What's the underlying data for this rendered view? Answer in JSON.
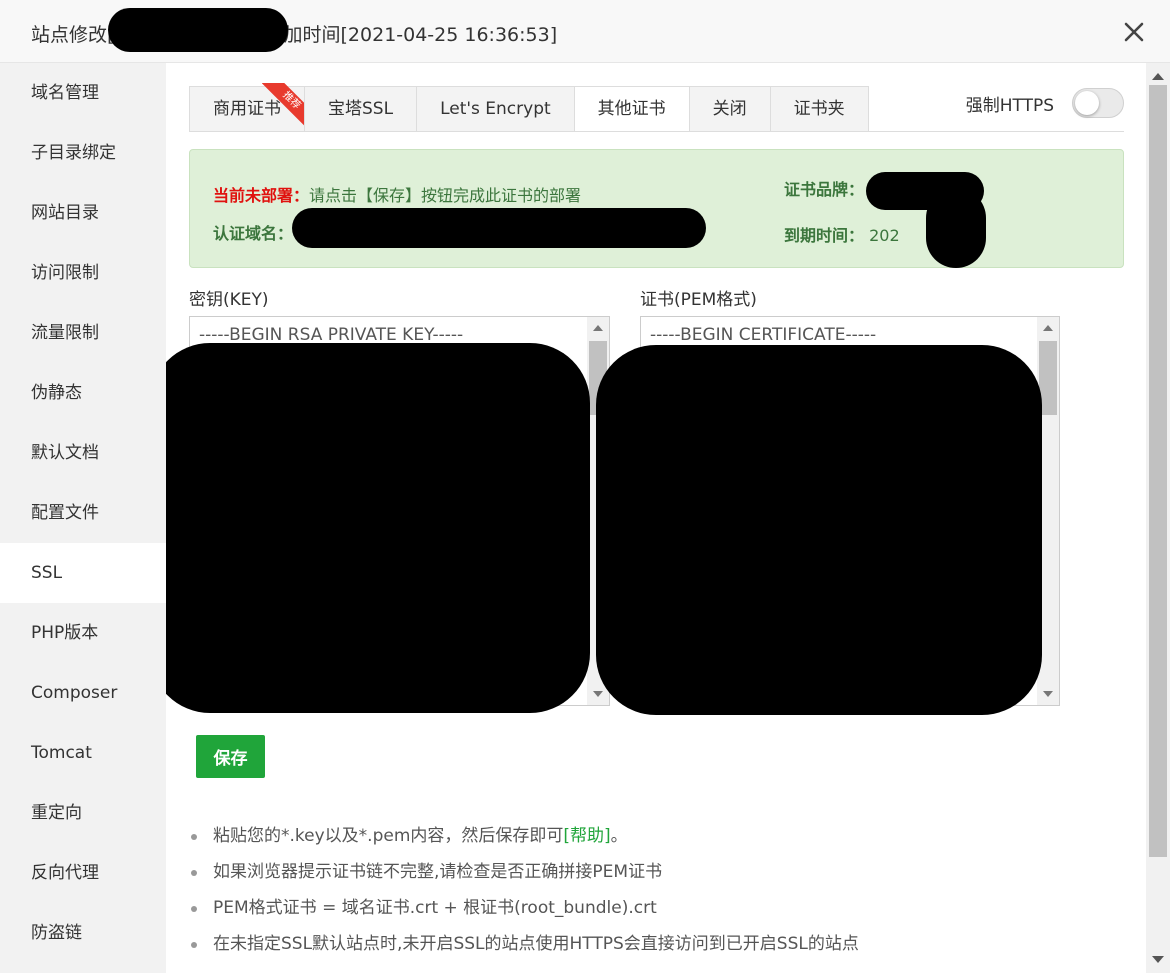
{
  "window": {
    "title": "站点修改[████████] -- 添加时间[2021-04-25 16:36:53]"
  },
  "sidebar": {
    "items": [
      {
        "label": "域名管理"
      },
      {
        "label": "子目录绑定"
      },
      {
        "label": "网站目录"
      },
      {
        "label": "访问限制"
      },
      {
        "label": "流量限制"
      },
      {
        "label": "伪静态"
      },
      {
        "label": "默认文档"
      },
      {
        "label": "配置文件"
      },
      {
        "label": "SSL",
        "active": true
      },
      {
        "label": "PHP版本"
      },
      {
        "label": "Composer"
      },
      {
        "label": "Tomcat"
      },
      {
        "label": "重定向"
      },
      {
        "label": "反向代理"
      },
      {
        "label": "防盗链"
      }
    ]
  },
  "tabs": [
    {
      "label": "商用证书",
      "badge": "推荐"
    },
    {
      "label": "宝塔SSL"
    },
    {
      "label": "Let's Encrypt"
    },
    {
      "label": "其他证书",
      "active": true
    },
    {
      "label": "关闭"
    },
    {
      "label": "证书夹"
    }
  ],
  "force_https": {
    "label": "强制HTTPS",
    "enabled": false
  },
  "notice": {
    "status_label": "当前未部署：",
    "status_text": "请点击【保存】按钮完成此证书的部署",
    "domain_label": "认证域名：",
    "brand_label": "证书品牌：",
    "expire_label": "到期时间：",
    "expire_value": "202"
  },
  "key_field": {
    "label": "密钥(KEY)",
    "value": "-----BEGIN RSA PRIVATE KEY-----"
  },
  "cert_field": {
    "label": "证书(PEM格式)",
    "value": "-----BEGIN CERTIFICATE-----"
  },
  "save_button": {
    "label": "保存"
  },
  "tips": {
    "tip1_prefix": "粘贴您的*.key以及*.pem内容，然后保存即可",
    "tip1_link": "[帮助]",
    "tip1_suffix": "。",
    "tip2": "如果浏览器提示证书链不完整,请检查是否正确拼接PEM证书",
    "tip3": "PEM格式证书 = 域名证书.crt + 根证书(root_bundle).crt",
    "tip4": "在未指定SSL默认站点时,未开启SSL的站点使用HTTPS会直接访问到已开启SSL的站点"
  },
  "colors": {
    "accent": "#20a53a",
    "notice_bg": "#dff0d8",
    "notice_red": "#e0120f",
    "notice_green": "#3c763d",
    "ribbon": "#e83a2d"
  }
}
